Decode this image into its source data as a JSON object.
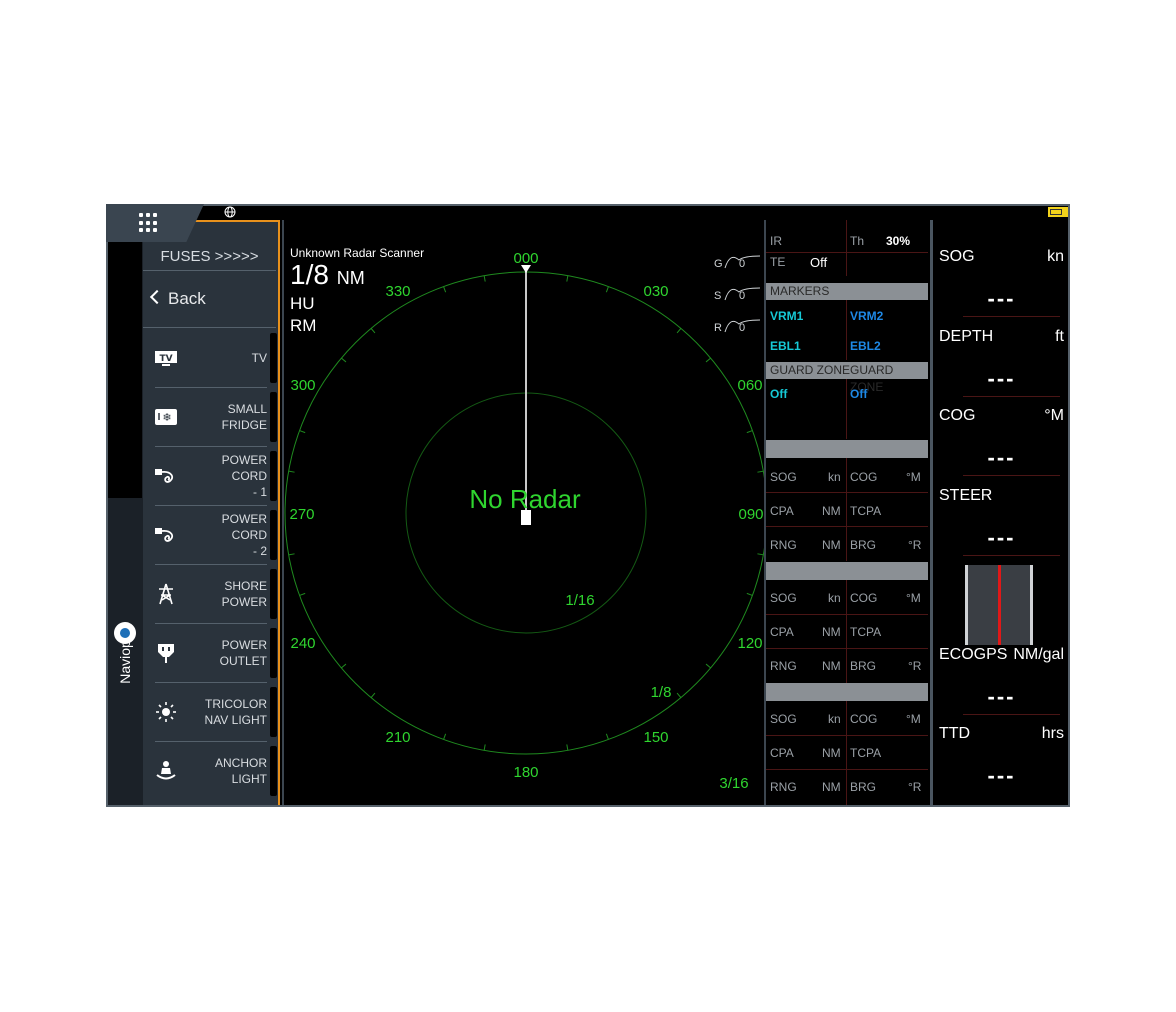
{
  "apps_icon": "grid-icon",
  "globe_icon": "globe-icon",
  "sidebar": {
    "brand": "Naviop",
    "title": "FUSES >>>>>",
    "back_label": "Back",
    "items": [
      {
        "label": "TV",
        "icon": "tv-icon"
      },
      {
        "label": "SMALL\nFRIDGE",
        "icon": "fridge-icon"
      },
      {
        "label": "POWER CORD\n- 1",
        "icon": "power-cord-icon"
      },
      {
        "label": "POWER CORD\n- 2",
        "icon": "power-cord-icon"
      },
      {
        "label": "SHORE\nPOWER",
        "icon": "shore-power-icon"
      },
      {
        "label": "POWER\nOUTLET",
        "icon": "power-outlet-icon"
      },
      {
        "label": "TRICOLOR\nNAV LIGHT",
        "icon": "tricolor-light-icon"
      },
      {
        "label": "ANCHOR\nLIGHT",
        "icon": "anchor-light-icon"
      }
    ]
  },
  "radar": {
    "scanner_name": "Unknown Radar Scanner",
    "range_value": "1/8",
    "range_unit": "NM",
    "orientation": "HU",
    "motion": "RM",
    "status": "No Radar",
    "bearing_labels": [
      "000",
      "030",
      "060",
      "090",
      "120",
      "150",
      "180",
      "210",
      "240",
      "270",
      "300",
      "330"
    ],
    "ring_labels": [
      "1/16",
      "1/8",
      "3/16"
    ],
    "gain": {
      "g_label": "G",
      "g_value": "0",
      "s_label": "S",
      "s_value": "0",
      "r_label": "R",
      "r_value": "0"
    },
    "accent_color": "#2fd52f"
  },
  "data_panel": {
    "ir_label": "IR",
    "th_label": "Th",
    "th_value": "30%",
    "te_label": "TE",
    "te_value": "Off",
    "markers_header": "MARKERS",
    "vrm1": "VRM1",
    "vrm2": "VRM2",
    "ebl1": "EBL1",
    "ebl2": "EBL2",
    "guard_zone_1": "GUARD ZONE",
    "guard_zone_2": "GUARD ZONE",
    "guard_1_value": "Off",
    "guard_2_value": "Off",
    "target_blocks": [
      {
        "sog": "SOG",
        "sog_unit": "kn",
        "cog": "COG",
        "cog_unit": "°M",
        "cpa": "CPA",
        "cpa_unit": "NM",
        "tcpa": "TCPA",
        "rng": "RNG",
        "rng_unit": "NM",
        "brg": "BRG",
        "brg_unit": "°R"
      },
      {
        "sog": "SOG",
        "sog_unit": "kn",
        "cog": "COG",
        "cog_unit": "°M",
        "cpa": "CPA",
        "cpa_unit": "NM",
        "tcpa": "TCPA",
        "rng": "RNG",
        "rng_unit": "NM",
        "brg": "BRG",
        "brg_unit": "°R"
      },
      {
        "sog": "SOG",
        "sog_unit": "kn",
        "cog": "COG",
        "cog_unit": "°M",
        "cpa": "CPA",
        "cpa_unit": "NM",
        "tcpa": "TCPA",
        "rng": "RNG",
        "rng_unit": "NM",
        "brg": "BRG",
        "brg_unit": "°R"
      }
    ]
  },
  "instruments": [
    {
      "title": "SOG",
      "unit": "kn",
      "value": "---"
    },
    {
      "title": "DEPTH",
      "unit": "ft",
      "value": "---"
    },
    {
      "title": "COG",
      "unit": "°M",
      "value": "---"
    },
    {
      "title": "STEER",
      "unit": "",
      "value": "---"
    },
    {
      "title": "ECOGPS",
      "unit": "NM/gal",
      "value": "---"
    },
    {
      "title": "TTD",
      "unit": "hrs",
      "value": "---"
    }
  ]
}
